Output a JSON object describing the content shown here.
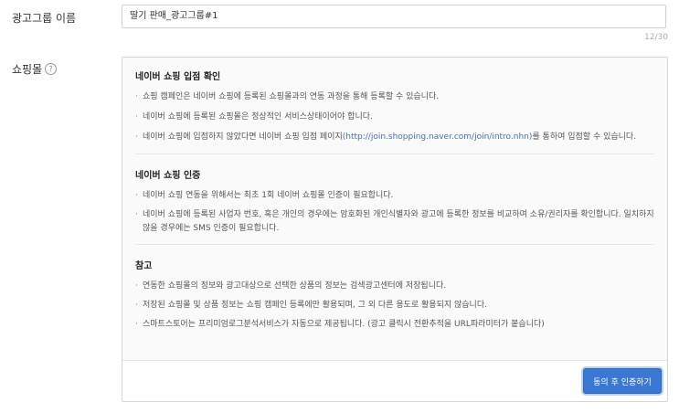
{
  "ad_group": {
    "label": "광고그룹 이름",
    "value": "딸기 판매_광고그룹#1",
    "char_count": "12/30"
  },
  "shopping": {
    "label": "쇼핑몰",
    "help_icon": "question-circle-icon",
    "sections": [
      {
        "title": "네이버 쇼핑 입점 확인",
        "bullets": [
          "쇼핑 캠페인은 네이버 쇼핑에 등록된 쇼핑몰과의 연동 과정을 통해 등록할 수 있습니다.",
          "네이버 쇼핑에 등록된 쇼핑몰은 정상적인 서비스상태이어야 합니다.",
          "네이버 쇼핑에 입점하지 않았다면 네이버 쇼핑 입점 페이지",
          "(http://join.shopping.naver.com/join/intro.nhn)",
          "를 통하여 입점할 수 있습니다."
        ]
      },
      {
        "title": "네이버 쇼핑 인증",
        "bullets": [
          "네이버 쇼핑 연동을 위해서는 최초 1회 네이버 쇼핑몰 인증이 필요합니다.",
          "네이버 쇼핑에 등록된 사업자 번호, 혹은 개인의 경우에는 암호화된 개인식별자와 광고에 등록한 정보를 비교하여 소유/권리자를 확인합니다. 일치하지 않을 경우에는 SMS 인증이 필요합니다."
        ]
      },
      {
        "title": "참고",
        "bullets": [
          "연동한 쇼핑몰의 정보와 광고대상으로 선택한 상품의 정보는 검색광고센터에 저장됩니다.",
          "저장된 쇼핑몰 및 상품 정보는 쇼핑 캠페인 등록에만 활용되며, 그 외 다른 용도로 활용되지 않습니다.",
          "스마트스토어는 프리미엄로그분석서비스가 자동으로 제공됩니다. (광고 클릭시 전환추적을 URL파라미터가 붙습니다)"
        ]
      }
    ],
    "agree_button": "동의 후 인증하기"
  }
}
